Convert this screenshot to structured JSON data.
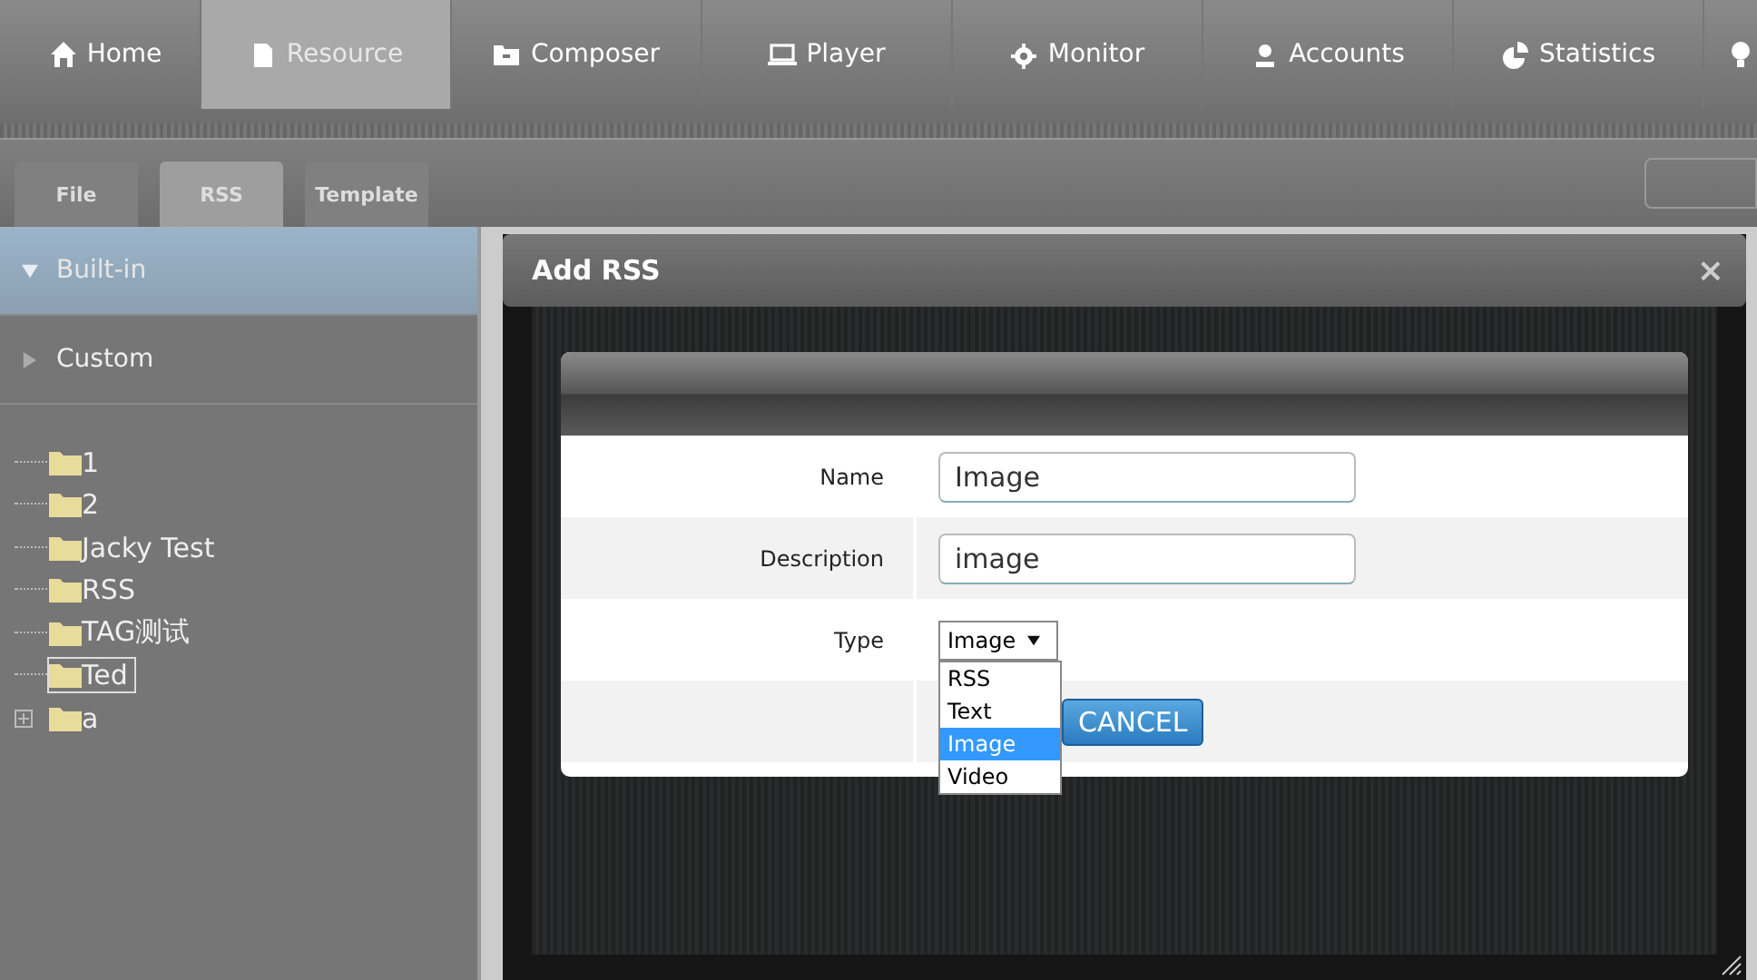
{
  "nav": [
    {
      "label": "Home",
      "selected": false
    },
    {
      "label": "Resource",
      "selected": true
    },
    {
      "label": "Composer",
      "selected": false
    },
    {
      "label": "Player",
      "selected": false
    },
    {
      "label": "Monitor",
      "selected": false
    },
    {
      "label": "Accounts",
      "selected": false
    },
    {
      "label": "Statistics",
      "selected": false
    },
    {
      "selected": false
    }
  ],
  "subtabs": [
    {
      "label": "File",
      "selected": false
    },
    {
      "label": "RSS",
      "selected": true
    },
    {
      "label": "Template",
      "selected": false
    }
  ],
  "sidebar": {
    "sections": [
      {
        "label": "Built-in",
        "expanded": true
      },
      {
        "label": "Custom",
        "expanded": false
      }
    ],
    "tree": [
      {
        "label": "1",
        "selected": false
      },
      {
        "label": "2",
        "selected": false
      },
      {
        "label": "Jacky Test",
        "selected": false
      },
      {
        "label": "RSS",
        "selected": false
      },
      {
        "label": "TAG测试",
        "selected": false
      },
      {
        "label": "Ted",
        "selected": true
      },
      {
        "label": "a",
        "selected": false,
        "expanded": false
      }
    ]
  },
  "dialog": {
    "title": "Add RSS",
    "close": "×",
    "fields": [
      {
        "kind": "text",
        "label": "Name",
        "value": "Image"
      },
      {
        "kind": "text",
        "label": "Description",
        "value": "image"
      },
      {
        "kind": "select",
        "label": "Type",
        "value": "Image",
        "open": true,
        "options": [
          {
            "label": "RSS",
            "selected": false
          },
          {
            "label": "Text",
            "selected": false
          },
          {
            "label": "Image",
            "selected": true
          },
          {
            "label": "Video",
            "selected": false
          }
        ]
      }
    ],
    "buttons": [
      "CANCEL"
    ]
  }
}
